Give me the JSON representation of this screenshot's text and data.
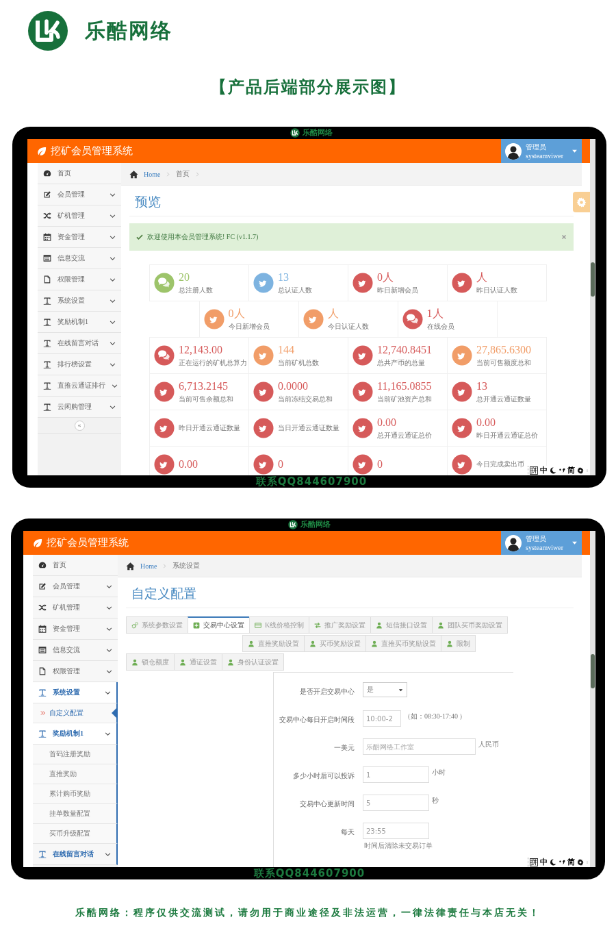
{
  "brand": {
    "name": "乐酷网络"
  },
  "headline": "【产品后端部分展示图】",
  "screens": [
    {
      "kind": "dashboard",
      "frame_brand": "乐酷网络",
      "contact": "联系QQ844607900",
      "app_title": "挖矿会员管理系统",
      "user": {
        "role": "管理员",
        "name": "systeamviwer"
      },
      "sidebar": [
        {
          "label": "首页",
          "kind": "gauge",
          "caret": false,
          "active": false
        },
        {
          "label": "会员管理",
          "kind": "edit",
          "caret": true,
          "active": false
        },
        {
          "label": "矿机管理",
          "kind": "shuffle",
          "caret": true,
          "active": false
        },
        {
          "label": "资金管理",
          "kind": "calendar",
          "caret": true,
          "active": false
        },
        {
          "label": "信息交流",
          "kind": "list",
          "caret": true,
          "active": false
        },
        {
          "label": "权限管理",
          "kind": "file",
          "caret": true,
          "active": false
        },
        {
          "label": "系统设置",
          "kind": "text",
          "caret": true,
          "active": false
        },
        {
          "label": "奖励机制1",
          "kind": "text",
          "caret": true,
          "active": false
        },
        {
          "label": "在线留言对话",
          "kind": "text",
          "caret": true,
          "active": false
        },
        {
          "label": "排行榜设置",
          "kind": "text",
          "caret": true,
          "active": false
        },
        {
          "label": "直推云通证排行",
          "kind": "text",
          "caret": true,
          "active": false
        },
        {
          "label": "云闲购管理",
          "kind": "text",
          "caret": true,
          "active": false
        }
      ],
      "collapse_button": "«",
      "crumbs": [
        {
          "label": "Home",
          "link": true
        },
        {
          "label": "首页",
          "link": false
        }
      ],
      "trailing_separator": true,
      "page_title": "预览",
      "alert": {
        "text": "欢迎使用本会员管理系统! FC (v1.1.7)"
      },
      "stat_rows": [
        [
          {
            "value": "20",
            "label": "总注册人数",
            "kind": "chat",
            "color": "#9dc46a"
          },
          {
            "value": "13",
            "label": "总认证人数",
            "kind": "bird",
            "color": "#7db3e0"
          },
          {
            "value": "0人",
            "label": "昨日新增会员",
            "kind": "bird",
            "color": "#d65a5a"
          },
          {
            "value": "人",
            "label": "昨日认证人数",
            "kind": "bird",
            "color": "#d65a5a"
          }
        ],
        [
          {
            "value": "0人",
            "label": "今日新增会员",
            "kind": "bird",
            "color": "#f19d68"
          },
          {
            "value": "人",
            "label": "今日认证人数",
            "kind": "bird",
            "color": "#f19d68"
          },
          {
            "value": "1人",
            "label": "在线会员",
            "kind": "chat",
            "color": "#d65a5a"
          }
        ],
        [
          {
            "value": "12,143.00",
            "label": "正在运行的矿机总算力",
            "kind": "chat",
            "color": "#d65a5a"
          },
          {
            "value": "144",
            "label": "当前矿机总数",
            "kind": "bird",
            "color": "#f19d68"
          },
          {
            "value": "12,740.8451",
            "label": "总共产币的总量",
            "kind": "bird",
            "color": "#d65a5a"
          },
          {
            "value": "27,865.6300",
            "label": "当前可售额度总和",
            "kind": "bird",
            "color": "#f19d68"
          }
        ],
        [
          {
            "value": "6,713.2145",
            "label": "当前可售余额总和",
            "kind": "bird",
            "color": "#d65a5a"
          },
          {
            "value": "0.0000",
            "label": "当前冻结交易总和",
            "kind": "bird",
            "color": "#d65a5a"
          },
          {
            "value": "11,165.0855",
            "label": "当前矿池资产总和",
            "kind": "bird",
            "color": "#d65a5a"
          },
          {
            "value": "13",
            "label": "总开通云通证数量",
            "kind": "bird",
            "color": "#d65a5a"
          }
        ],
        [
          {
            "label": "昨日开通云通证数量",
            "kind": "bird",
            "color": "#d65a5a"
          },
          {
            "label": "当日开通云通证数量",
            "kind": "bird",
            "color": "#d65a5a"
          },
          {
            "value": "0.00",
            "label": "总开通云通证总价",
            "kind": "bird",
            "color": "#d65a5a"
          },
          {
            "value": "0.00",
            "label": "昨日开通云通证总价",
            "kind": "bird",
            "color": "#d65a5a"
          }
        ],
        [
          {
            "value": "0.00",
            "kind": "bird",
            "color": "#d65a5a"
          },
          {
            "value": "0",
            "kind": "bird",
            "color": "#d65a5a"
          },
          {
            "value": "0",
            "kind": "bird",
            "color": "#d65a5a"
          },
          {
            "label": "今日完成卖出币",
            "kind": "bird",
            "color": "#d65a5a"
          }
        ]
      ],
      "ime_bar": [
        {
          "kind": "key",
          "text": "拼"
        },
        {
          "kind": "text",
          "text": "中"
        },
        {
          "kind": "moon"
        },
        {
          "kind": "punct"
        },
        {
          "kind": "text",
          "text": "简"
        },
        {
          "kind": "gear"
        },
        {
          "kind": "grip"
        }
      ]
    },
    {
      "kind": "settings",
      "frame_brand": "乐酷网络",
      "contact": "联系QQ844607900",
      "app_title": "挖矿会员管理系统",
      "user": {
        "role": "管理员",
        "name": "systeamviwer"
      },
      "sidebar": [
        {
          "label": "首页",
          "kind": "gauge",
          "caret": false,
          "active": false
        },
        {
          "label": "会员管理",
          "kind": "edit",
          "caret": true,
          "active": false
        },
        {
          "label": "矿机管理",
          "kind": "shuffle",
          "caret": true,
          "active": false
        },
        {
          "label": "资金管理",
          "kind": "calendar",
          "caret": true,
          "active": false
        },
        {
          "label": "信息交流",
          "kind": "list",
          "caret": true,
          "active": false
        },
        {
          "label": "权限管理",
          "kind": "file",
          "caret": true,
          "active": false
        },
        {
          "label": "系统设置",
          "kind": "text",
          "caret": true,
          "active": true,
          "children": [
            {
              "label": "自定义配置",
              "selected": true
            }
          ]
        },
        {
          "label": "奖励机制1",
          "kind": "text",
          "caret": true,
          "active": true,
          "children": [
            {
              "label": "首码注册奖励",
              "selected": false
            },
            {
              "label": "直推奖励",
              "selected": false
            },
            {
              "label": "累计购币奖励",
              "selected": false
            },
            {
              "label": "挂单数量配置",
              "selected": false
            },
            {
              "label": "买币升级配置",
              "selected": false
            }
          ]
        },
        {
          "label": "在线留言对话",
          "kind": "text",
          "caret": true,
          "active": true
        }
      ],
      "crumbs": [
        {
          "label": "Home",
          "link": true
        },
        {
          "label": "系统设置",
          "link": false
        }
      ],
      "trailing_separator": false,
      "page_title": "自定义配置",
      "tab_rows": [
        [
          {
            "label": "系统参数设置",
            "kind": "gears",
            "selected": false
          },
          {
            "label": "交易中心设置",
            "kind": "plus",
            "selected": true
          },
          {
            "label": "K线价格控制",
            "kind": "card",
            "selected": false
          },
          {
            "label": "推广奖励设置",
            "kind": "arrows",
            "selected": false
          },
          {
            "label": "短信接口设置",
            "kind": "user",
            "selected": false
          },
          {
            "label": "团队买币奖励设置",
            "kind": "user",
            "selected": false
          }
        ],
        [
          {
            "label": "直推奖励设置",
            "kind": "user",
            "selected": false
          },
          {
            "label": "买币奖励设置",
            "kind": "user",
            "selected": false
          },
          {
            "label": "直推买币奖励设置",
            "kind": "user",
            "selected": false
          },
          {
            "label": "限制",
            "kind": "user",
            "selected": false
          }
        ],
        [
          {
            "label": "锁仓额度",
            "kind": "user",
            "selected": false
          },
          {
            "label": "通证设置",
            "kind": "user",
            "selected": false
          },
          {
            "label": "身份认证设置",
            "kind": "user",
            "selected": false
          }
        ]
      ],
      "form": [
        {
          "label": "是否开启交易中心",
          "kind": "select",
          "value": "是"
        },
        {
          "label": "交易中心每日开启时间段",
          "kind": "input",
          "value": "10:00-2",
          "suffix": "（如：08:30-17:40 ）"
        },
        {
          "label": "一美元",
          "kind": "input",
          "placeholder": "乐酷网络工作室",
          "suffix": "人民币"
        },
        {
          "label": "多少小时后可以投诉",
          "kind": "input",
          "value": "1",
          "suffix": "小时"
        },
        {
          "label": "交易中心更新时间",
          "kind": "input",
          "value": "5",
          "suffix": "秒"
        },
        {
          "label": "每天",
          "kind": "input",
          "value": "23:55",
          "help": "时间后清除未交易订单"
        }
      ],
      "ime_bar": [
        {
          "kind": "key",
          "text": "拼"
        },
        {
          "kind": "text",
          "text": "中"
        },
        {
          "kind": "moon"
        },
        {
          "kind": "punct"
        },
        {
          "kind": "text",
          "text": "简"
        },
        {
          "kind": "gear"
        },
        {
          "kind": "grip"
        }
      ]
    }
  ],
  "disclaimer": "乐酷网络：程序仅供交流测试，请勿用于商业途径及非法运营，一律法律责任与本店无关！"
}
